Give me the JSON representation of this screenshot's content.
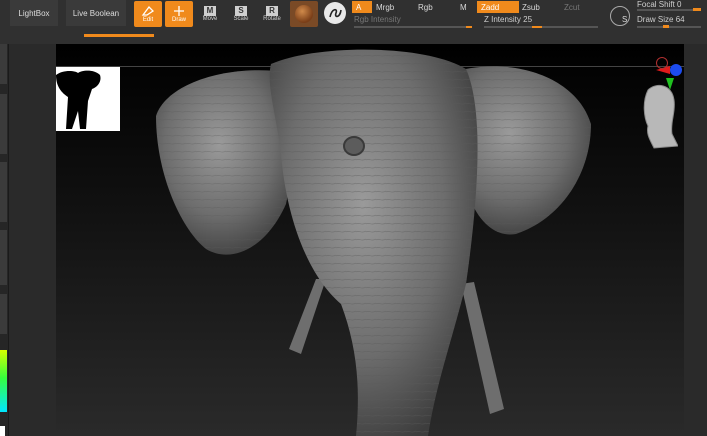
{
  "toolbar": {
    "lightbox_label": "LightBox",
    "live_boolean_label": "Live Boolean",
    "tools": [
      {
        "label": "Edit",
        "icon": "edit-icon",
        "active": true
      },
      {
        "label": "Draw",
        "icon": "draw-icon",
        "active": true
      },
      {
        "label": "Move",
        "icon": "move-icon",
        "active": false
      },
      {
        "label": "Scale",
        "icon": "scale-icon",
        "active": false
      },
      {
        "label": "Rotate",
        "icon": "rotate-icon",
        "active": false
      }
    ],
    "modes": {
      "a": "A",
      "mrgb": "Mrgb",
      "rgb": "Rgb",
      "m": "M",
      "zadd": "Zadd",
      "zsub": "Zsub",
      "zcut": "Zcut"
    },
    "rgb_intensity_label": "Rgb Intensity",
    "z_intensity": {
      "label": "Z Intensity",
      "value": "25"
    },
    "focal_shift": {
      "label": "Focal Shift",
      "value": "0"
    },
    "draw_size": {
      "label": "Draw Size",
      "value": "64"
    }
  },
  "colors": {
    "accent": "#f08a1c",
    "bg": "#2a2a2a"
  },
  "canvas": {
    "model": "elephant-head sculpt"
  }
}
